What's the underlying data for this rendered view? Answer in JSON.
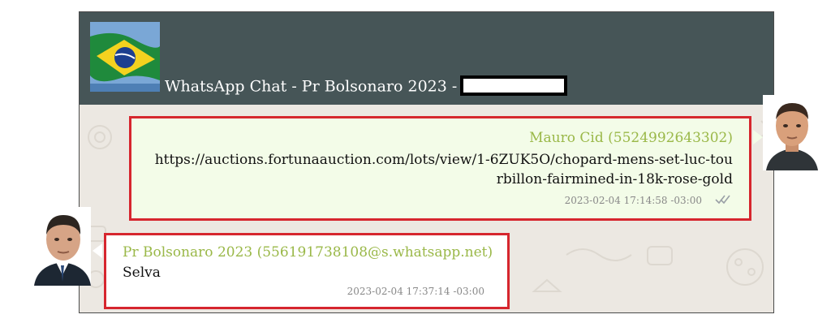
{
  "window": {
    "title": "WhatsApp Chat - Pr Bolsonaro 2023 -",
    "header_color": "#465557",
    "chat_background": "#ece8e2",
    "highlight_color": "#d6262e"
  },
  "icons": {
    "group_icon": "brazil-flag-icon",
    "read_status": "double-check-icon"
  },
  "messages": [
    {
      "direction": "outgoing",
      "sender": "Mauro Cid (5524992643302)",
      "text": "https://auctions.fortunaauction.com/lots/view/1-6ZUK5O/chopard-mens-set-luc-tourbillon-fairmined-in-18k-rose-gold",
      "timestamp": "2023-02-04 17:14:58 -03:00",
      "bubble_color": "#f3fce8"
    },
    {
      "direction": "incoming",
      "sender": "Pr Bolsonaro 2023 (556191738108@s.whatsapp.net)",
      "text": "Selva",
      "timestamp": "2023-02-04 17:37:14 -03:00",
      "bubble_color": "#ffffff"
    }
  ]
}
